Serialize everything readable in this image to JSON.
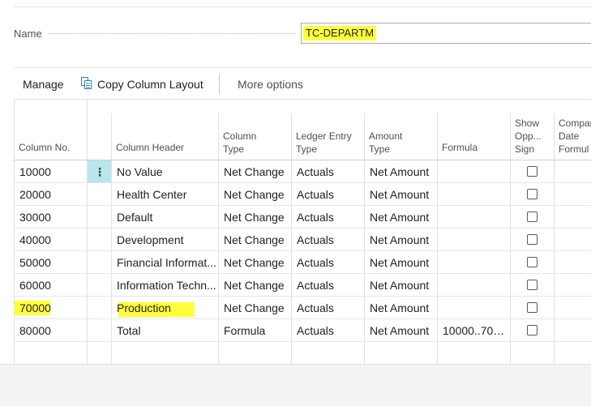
{
  "name_field": {
    "label": "Name",
    "value": "TC-DEPARTM"
  },
  "actions": {
    "manage": "Manage",
    "copy_column_layout": "Copy Column Layout",
    "more_options": "More options"
  },
  "grid": {
    "headers": {
      "column_no": "Column No.",
      "column_header": "Column Header",
      "column_type": [
        "Column",
        "Type"
      ],
      "ledger_entry_type": [
        "Ledger Entry",
        "Type"
      ],
      "amount_type": [
        "Amount",
        "Type"
      ],
      "formula": "Formula",
      "show_opp_sign": [
        "Show",
        "Opp...",
        "Sign"
      ],
      "comparison_date_formula": [
        "Compar",
        "Date",
        "Formul"
      ]
    },
    "rows": [
      {
        "column_no": "10000",
        "column_header": "No Value",
        "column_type": "Net Change",
        "ledger_entry_type": "Actuals",
        "amount_type": "Net Amount",
        "formula": ""
      },
      {
        "column_no": "20000",
        "column_header": "Health Center",
        "column_type": "Net Change",
        "ledger_entry_type": "Actuals",
        "amount_type": "Net Amount",
        "formula": ""
      },
      {
        "column_no": "30000",
        "column_header": "Default",
        "column_type": "Net Change",
        "ledger_entry_type": "Actuals",
        "amount_type": "Net Amount",
        "formula": ""
      },
      {
        "column_no": "40000",
        "column_header": "Development",
        "column_type": "Net Change",
        "ledger_entry_type": "Actuals",
        "amount_type": "Net Amount",
        "formula": ""
      },
      {
        "column_no": "50000",
        "column_header": "Financial Informat...",
        "column_type": "Net Change",
        "ledger_entry_type": "Actuals",
        "amount_type": "Net Amount",
        "formula": ""
      },
      {
        "column_no": "60000",
        "column_header": "Information Techn...",
        "column_type": "Net Change",
        "ledger_entry_type": "Actuals",
        "amount_type": "Net Amount",
        "formula": ""
      },
      {
        "column_no": "70000",
        "column_header": "Production",
        "column_type": "Net Change",
        "ledger_entry_type": "Actuals",
        "amount_type": "Net Amount",
        "formula": ""
      },
      {
        "column_no": "80000",
        "column_header": "Total",
        "column_type": "Formula",
        "ledger_entry_type": "Actuals",
        "amount_type": "Net Amount",
        "formula": "10000..700..."
      }
    ]
  },
  "colors": {
    "highlight": "#ffff3c",
    "selected_row_marker": "#b7e7ec"
  }
}
